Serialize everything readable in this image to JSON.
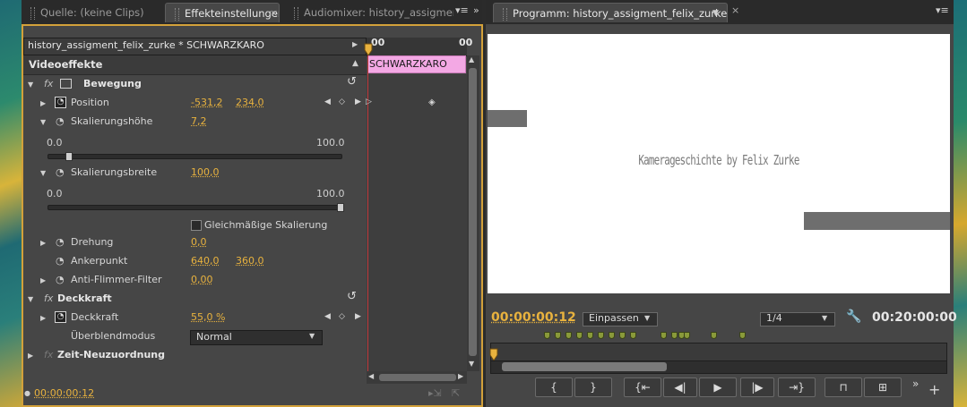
{
  "left_tabs": {
    "tab_source": "Quelle: (keine Clips)",
    "tab_effects": "Effekteinstellungen",
    "tab_audiomixer": "Audiomixer: history_assigment_"
  },
  "effects": {
    "sequence_title": "history_assigment_felix_zurke * SCHWARZKARO",
    "section_header": "Videoeffekte",
    "timeline_start": "00",
    "timeline_end": "00",
    "clip_label": "SCHWARZKARO",
    "bewegung": "Bewegung",
    "position_label": "Position",
    "position_x": "-531,2",
    "position_y": "234,0",
    "scale_height_label": "Skalierungshöhe",
    "scale_height_value": "7,2",
    "scale_height_min": "0.0",
    "scale_height_max": "100.0",
    "scale_height_level": 0.072,
    "scale_width_label": "Skalierungsbreite",
    "scale_width_value": "100,0",
    "scale_width_min": "0.0",
    "scale_width_max": "100.0",
    "scale_width_level": 1.0,
    "uniform_scale_label": "Gleichmäßige Skalierung",
    "rotation_label": "Drehung",
    "rotation_value": "0,0",
    "anchor_label": "Ankerpunkt",
    "anchor_x": "640,0",
    "anchor_y": "360,0",
    "antiflicker_label": "Anti-Flimmer-Filter",
    "antiflicker_value": "0,00",
    "opacity_section": "Deckkraft",
    "opacity_label": "Deckkraft",
    "opacity_value": "55,0 %",
    "blend_label": "Überblendmodus",
    "blend_value": "Normal",
    "time_remap": "Zeit-Neuzuordnung",
    "footer_time": "00:00:00:12"
  },
  "program": {
    "tab_title": "Programm: history_assigment_felix_zurke",
    "video_caption": "Kamerageschichte by Felix Zurke",
    "current_time": "00:00:00:12",
    "fit_label": "Einpassen",
    "resolution_label": "1/4",
    "duration": "00:20:00:00"
  },
  "icons": {
    "fx": "fx-icon",
    "stopwatch": "stopwatch-icon",
    "reset": "reset-icon",
    "wrench": "wrench-icon",
    "playhead": "playhead-icon"
  },
  "colors": {
    "accent_orange": "#e8b23e",
    "panel_border": "#d3a13a",
    "clip_pink": "#f3a8e4",
    "playhead_red": "#c0393b",
    "marker_green": "#8a9a3a"
  }
}
